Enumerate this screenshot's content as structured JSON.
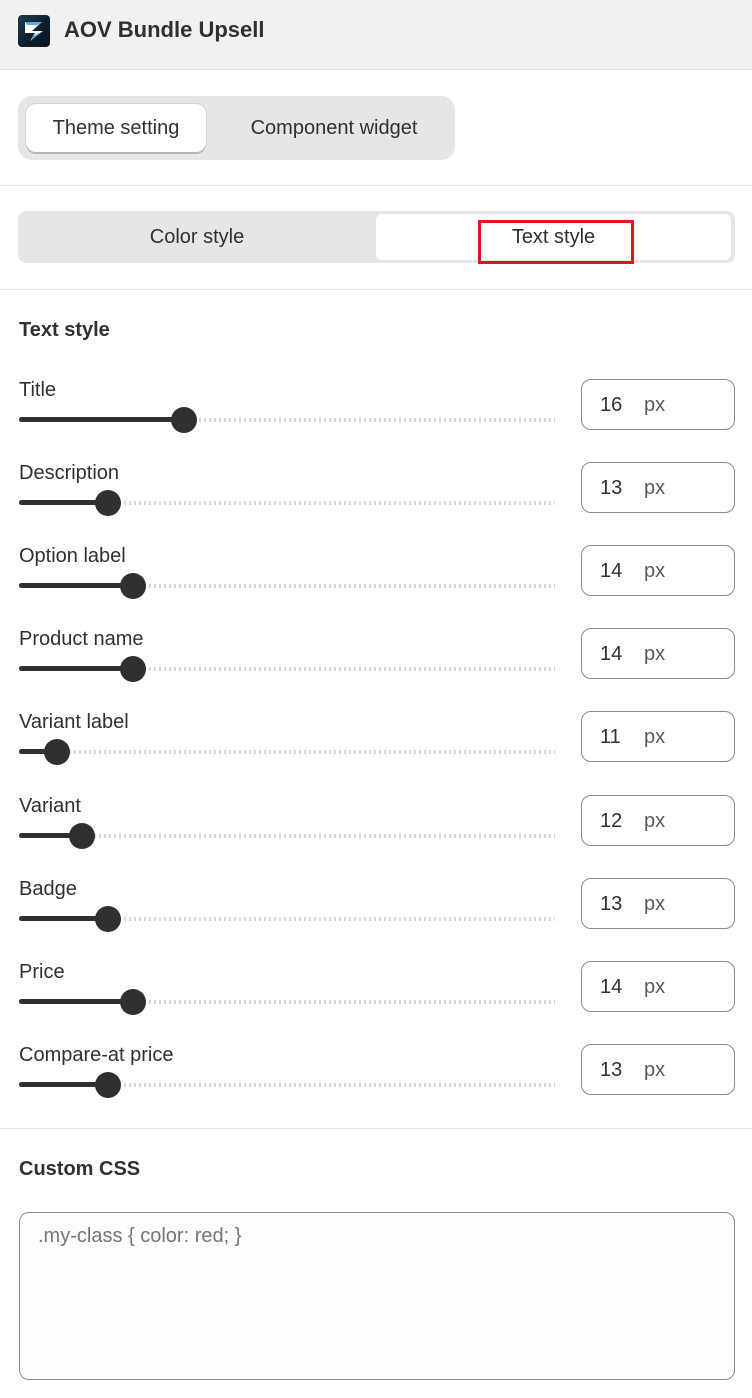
{
  "app": {
    "title": "AOV Bundle Upsell"
  },
  "top_tabs": [
    {
      "label": "Theme setting",
      "active": true
    },
    {
      "label": "Component widget",
      "active": false
    }
  ],
  "style_tabs": [
    {
      "label": "Color style",
      "active": false
    },
    {
      "label": "Text style",
      "active": true
    }
  ],
  "text_style": {
    "heading": "Text style",
    "unit": "px",
    "rows": [
      {
        "label": "Title",
        "value": "16"
      },
      {
        "label": "Description",
        "value": "13"
      },
      {
        "label": "Option label",
        "value": "14"
      },
      {
        "label": "Product name",
        "value": "14"
      },
      {
        "label": "Variant label",
        "value": "11"
      },
      {
        "label": "Variant",
        "value": "12"
      },
      {
        "label": "Badge",
        "value": "13"
      },
      {
        "label": "Price",
        "value": "14"
      },
      {
        "label": "Compare-at price",
        "value": "13"
      }
    ]
  },
  "custom_css": {
    "heading": "Custom CSS",
    "placeholder": ".my-class { color: red; }"
  },
  "colors": {
    "highlight": "#e0161d",
    "slider": "#303030"
  }
}
